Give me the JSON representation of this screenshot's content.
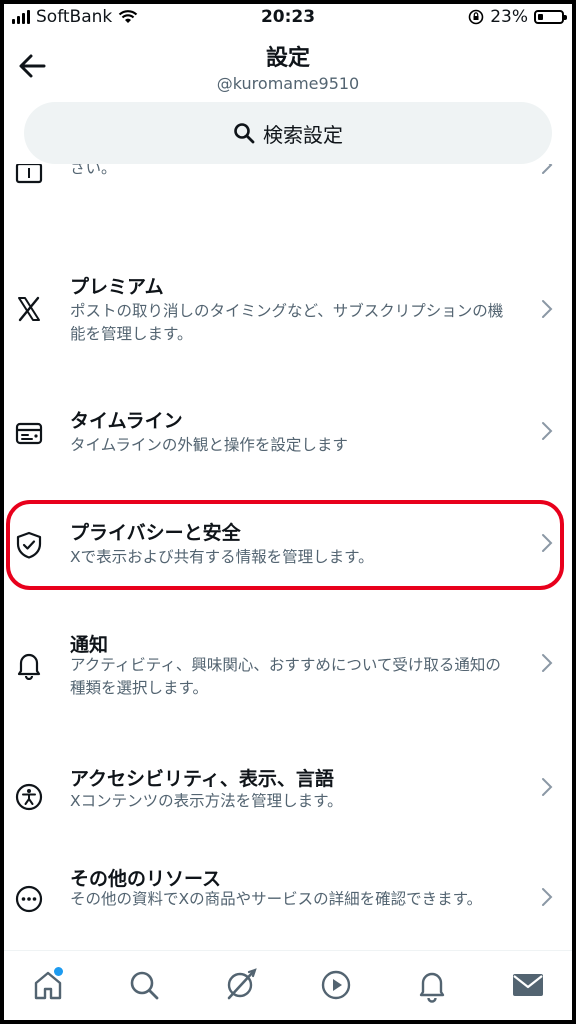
{
  "status_bar": {
    "carrier": "SoftBank",
    "time": "20:23",
    "battery": "23%"
  },
  "header": {
    "title": "設定",
    "handle": "@kuromame9510",
    "search_label": "検索設定"
  },
  "items": [
    {
      "icon": "money-icon",
      "title": "",
      "desc": "Xで収益を得る方法や収益化オプションの管理方法をご覧ください。"
    },
    {
      "icon": "x-logo-icon",
      "title": "プレミアム",
      "desc": "ポストの取り消しのタイミングなど、サブスクリプションの機能を管理します。"
    },
    {
      "icon": "timeline-icon",
      "title": "タイムライン",
      "desc": "タイムラインの外観と操作を設定します"
    },
    {
      "icon": "shield-icon",
      "title": "プライバシーと安全",
      "desc": "Xで表示および共有する情報を管理します。"
    },
    {
      "icon": "bell-icon",
      "title": "通知",
      "desc": "アクティビティ、興味関心、おすすめについて受け取る通知の種類を選択します。"
    },
    {
      "icon": "accessibility-icon",
      "title": "アクセシビリティ、表示、言語",
      "desc": "Xコンテンツの表示方法を管理します。"
    },
    {
      "icon": "more-icon",
      "title": "その他のリソース",
      "desc": "その他の資料でXの商品やサービスの詳細を確認できます。"
    }
  ],
  "bottom_nav": [
    "home-icon",
    "search-icon",
    "grok-icon",
    "video-icon",
    "bell-icon",
    "mail-icon"
  ],
  "colors": {
    "highlight": "#e8001c",
    "accent": "#1d9bf0",
    "secondary_text": "#536471"
  }
}
